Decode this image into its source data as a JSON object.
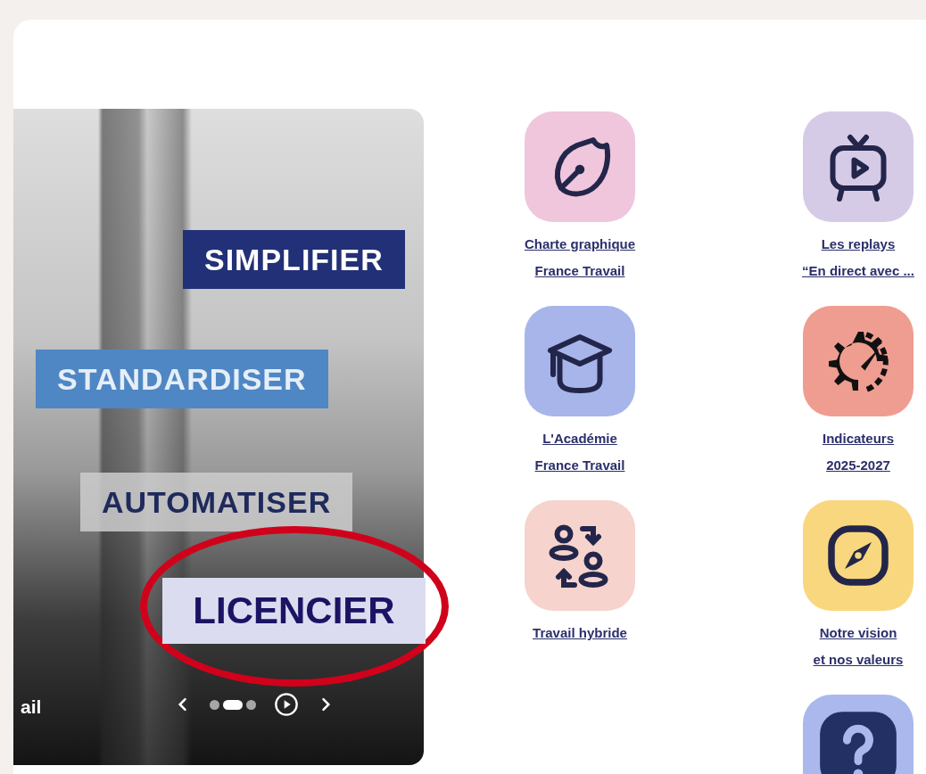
{
  "carousel": {
    "banners": [
      {
        "text": "SIMPLIFIER",
        "kind": "navy"
      },
      {
        "text": "STANDARDISER",
        "kind": "blue"
      },
      {
        "text": "AUTOMATISER",
        "kind": "grey"
      }
    ],
    "caption": "ail",
    "dots": [
      {
        "selected": false
      },
      {
        "selected": true
      },
      {
        "selected": false
      }
    ]
  },
  "annotation": {
    "text": "LICENCIER"
  },
  "columns": [
    [
      {
        "kind": "pen",
        "color": "#efc6dc",
        "label_lines": [
          "Charte graphique",
          "France Travail"
        ]
      },
      {
        "kind": "cap",
        "color": "#a7b5ea",
        "label_lines": [
          "L'Académie",
          "France Travail"
        ]
      },
      {
        "kind": "people",
        "color": "#f6d3cd",
        "label_lines": [
          "Travail hybride"
        ]
      }
    ],
    [
      {
        "kind": "tv",
        "color": "#d6cbe6",
        "label_lines": [
          "Les replays",
          "“En direct avec ..."
        ]
      },
      {
        "kind": "gauge",
        "color": "#ef9d90",
        "label_lines": [
          "Indicateurs",
          "2025-2027"
        ]
      },
      {
        "kind": "compass",
        "color": "#f9d77e",
        "label_lines": [
          "Notre vision",
          "et nos valeurs"
        ]
      },
      {
        "kind": "help",
        "color": "#aab8ee"
      }
    ]
  ]
}
